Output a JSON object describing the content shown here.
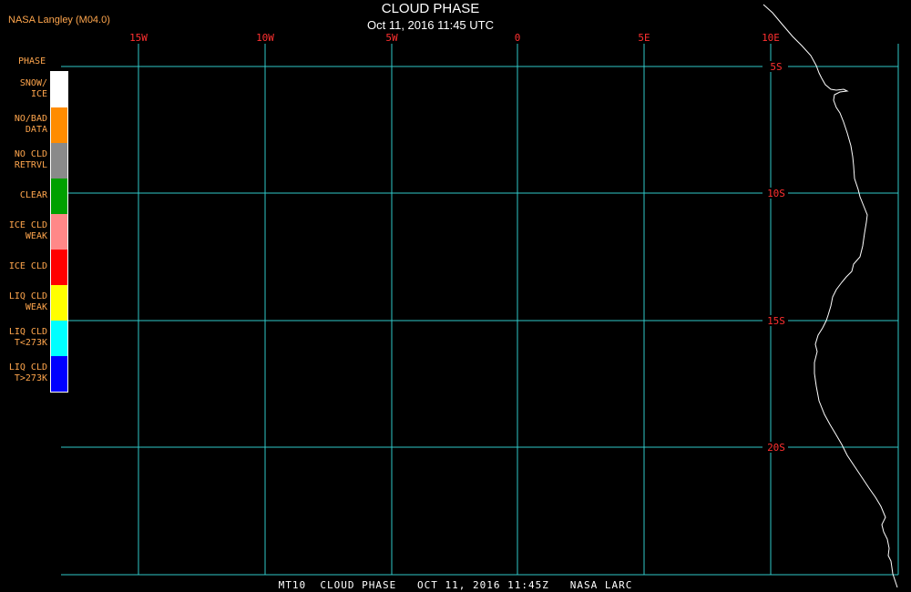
{
  "header": {
    "credit": "NASA Langley (M04.0)",
    "title": "CLOUD PHASE",
    "subtitle": "Oct 11, 2016 11:45 UTC"
  },
  "footer": {
    "text": "MT10  CLOUD PHASE   OCT 11, 2016 11:45Z   NASA LARC"
  },
  "legend": {
    "title": "PHASE",
    "items": [
      {
        "label": "SNOW/\nICE",
        "color": "#ffffff"
      },
      {
        "label": "NO/BAD\nDATA",
        "color": "#ff8c00"
      },
      {
        "label": "NO CLD\nRETRVL",
        "color": "#8a8a8a"
      },
      {
        "label": "CLEAR",
        "color": "#00a000"
      },
      {
        "label": "ICE CLD\nWEAK",
        "color": "#ff8888"
      },
      {
        "label": "ICE CLD",
        "color": "#ff0000"
      },
      {
        "label": "LIQ CLD\nWEAK",
        "color": "#ffff00"
      },
      {
        "label": "LIQ CLD\nT<273K",
        "color": "#00ffff"
      },
      {
        "label": "LIQ CLD\nT>273K",
        "color": "#0000ff"
      }
    ]
  },
  "map": {
    "grid_color": "#30c8c8",
    "label_color": "#ff3030",
    "coast_color": "#ffffff",
    "longitude_labels": [
      "15W",
      "10W",
      "5W",
      "0",
      "5E",
      "10E"
    ],
    "latitude_labels": [
      "5S",
      "10S",
      "15S",
      "20S"
    ]
  }
}
